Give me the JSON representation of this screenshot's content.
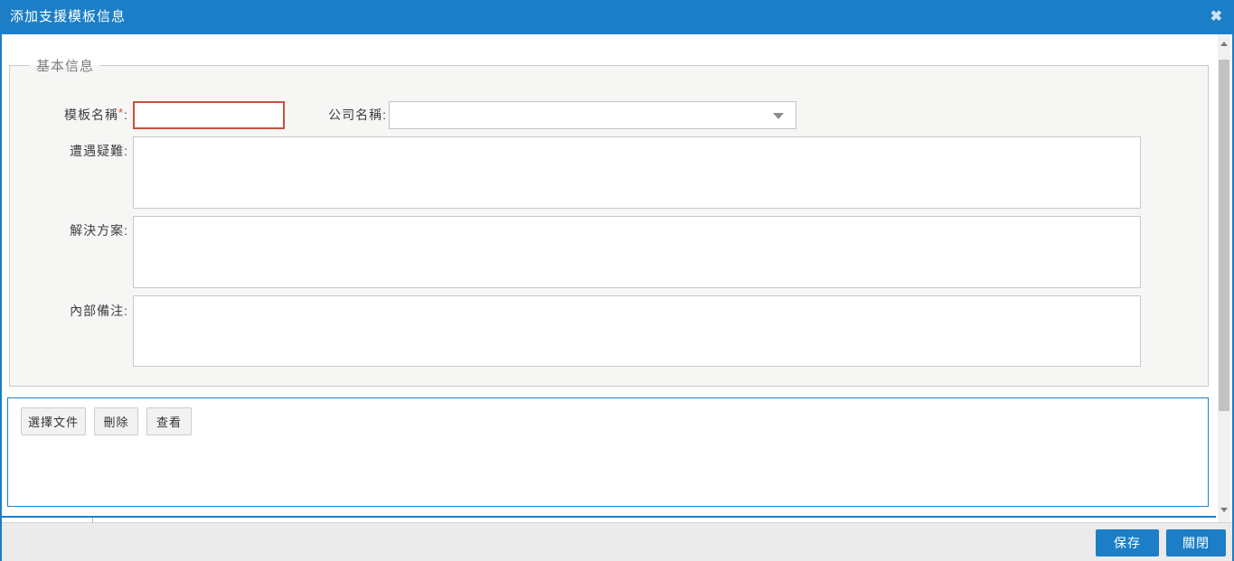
{
  "titlebar": {
    "title": "添加支援模板信息",
    "close_icon": "✖"
  },
  "form": {
    "legend": "基本信息",
    "template_name": {
      "label": "模板名稱",
      "required_mark": "*",
      "colon": ":",
      "value": ""
    },
    "company": {
      "label": "公司名稱:",
      "selected_value": ""
    },
    "difficulty": {
      "label": "遭遇疑難:",
      "value": ""
    },
    "solution": {
      "label": "解決方案:",
      "value": ""
    },
    "note": {
      "label": "內部備注:",
      "value": ""
    }
  },
  "attachments": {
    "choose_label": "選擇文件",
    "delete_label": "刪除",
    "view_label": "查看"
  },
  "footer": {
    "save_label": "保存",
    "close_label": "關閉"
  },
  "colors": {
    "accent_blue": "#1b7ec6",
    "panel_border_blue": "#1f83c9",
    "required_red": "#c5503f",
    "fieldset_bg": "#f6f6f5",
    "footer_bg": "#ebebeb"
  }
}
